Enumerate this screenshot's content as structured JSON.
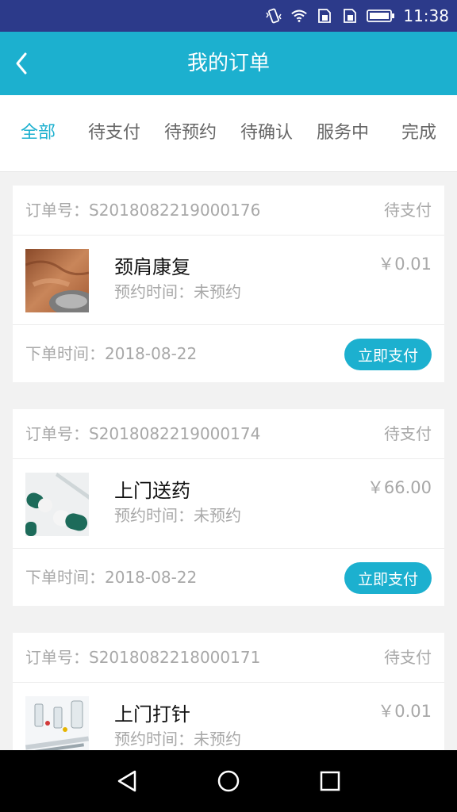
{
  "status_bar": {
    "time": "11:38",
    "icons": [
      "vibrate-icon",
      "wifi-icon",
      "sim1-icon",
      "sim2-icon",
      "battery-icon"
    ]
  },
  "app_bar": {
    "title": "我的订单",
    "back_icon": "chevron-left-icon"
  },
  "tabs": [
    {
      "label": "全部",
      "active": true
    },
    {
      "label": "待支付",
      "active": false
    },
    {
      "label": "待预约",
      "active": false
    },
    {
      "label": "待确认",
      "active": false
    },
    {
      "label": "服务中",
      "active": false
    },
    {
      "label": "完成",
      "active": false
    }
  ],
  "orders": [
    {
      "order_no": "订单号：S2018082219000176",
      "status": "待支付",
      "service": "颈肩康复",
      "appointment": "预约时间：未预约",
      "price": "￥0.01",
      "order_time": "下单时间：2018-08-22",
      "action": "立即支付"
    },
    {
      "order_no": "订单号：S2018082219000174",
      "status": "待支付",
      "service": "上门送药",
      "appointment": "预约时间：未预约",
      "price": "￥66.00",
      "order_time": "下单时间：2018-08-22",
      "action": "立即支付"
    },
    {
      "order_no": "订单号：S2018082218000171",
      "status": "待支付",
      "service": "上门打针",
      "appointment": "预约时间：未预约",
      "price": "￥0.01"
    }
  ],
  "nav_bar": {
    "icons": [
      "back-triangle-icon",
      "home-circle-icon",
      "recents-square-icon"
    ]
  },
  "colors": {
    "accent": "#1cb0cf",
    "status_bar": "#2c3a8a",
    "background": "#f2f2f2"
  }
}
